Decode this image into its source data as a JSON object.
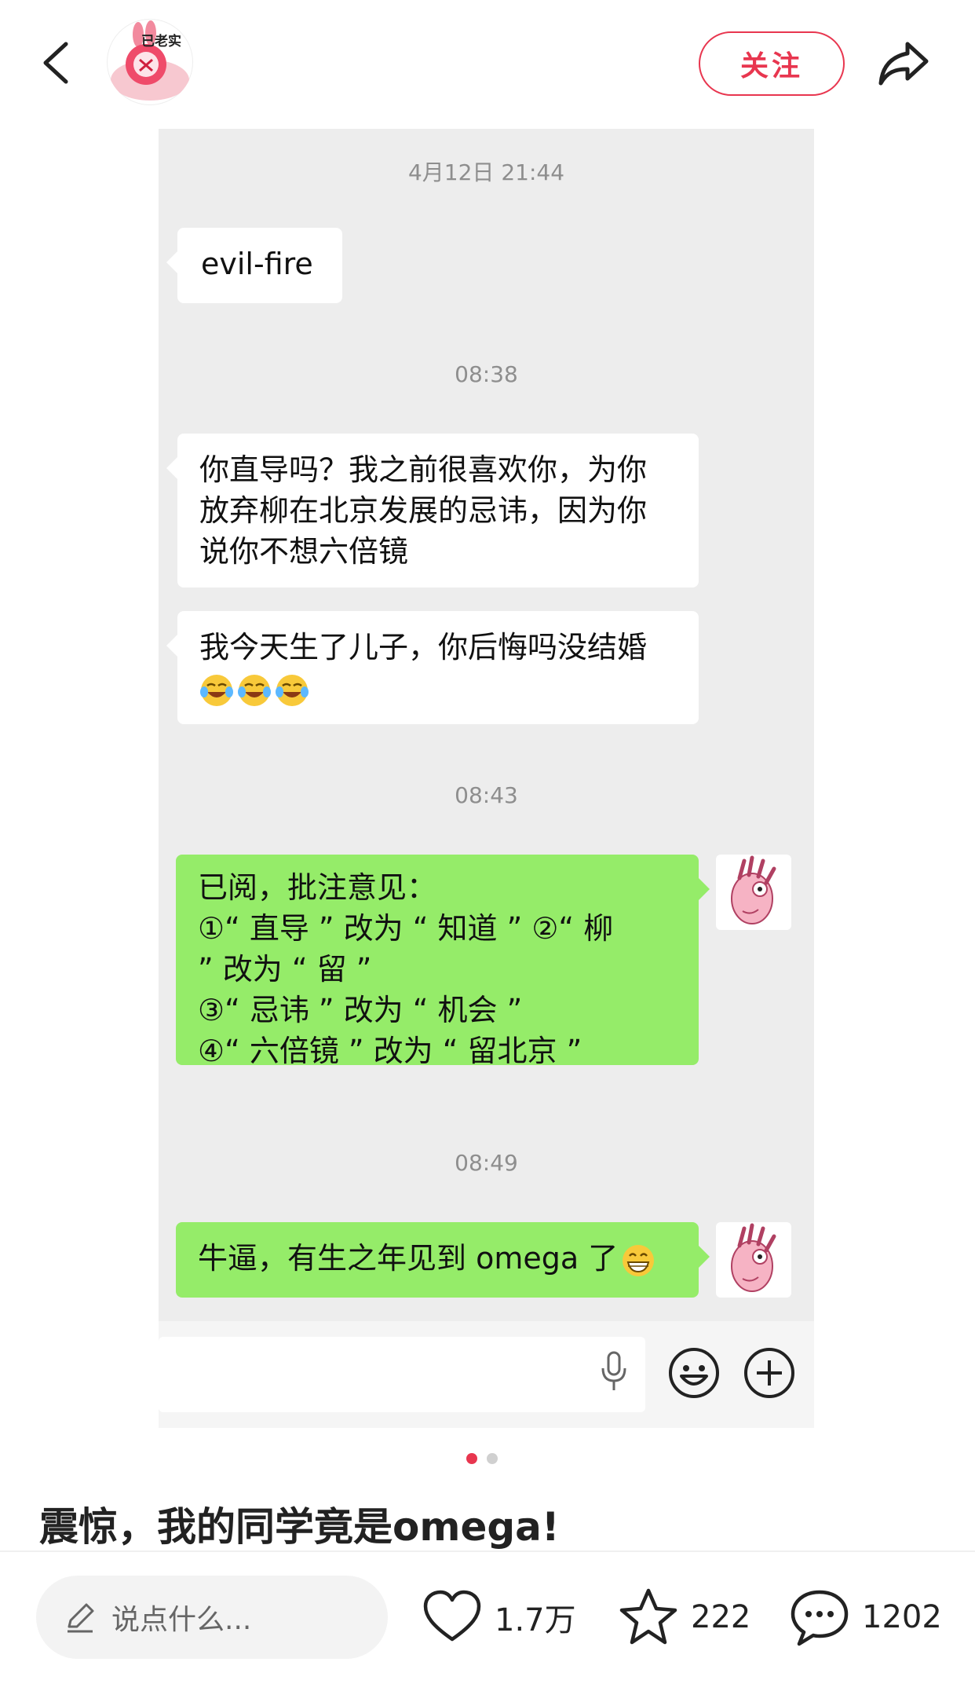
{
  "header": {
    "avatar_text": "已老实",
    "follow_label": "关注"
  },
  "chat": {
    "timestamps": [
      "4月12日 21:44",
      "08:38",
      "08:43",
      "08:49"
    ],
    "msg1": "evil-fire",
    "msg2_lines": [
      "你直导吗？我之前很喜欢你，为你",
      "放弃柳在北京发展的忌讳，因为你",
      "说你不想六倍镜"
    ],
    "msg3_line": "我今天生了儿子，你后悔吗没结婚",
    "msg4_lines": [
      "已阅，批注意见：",
      "①“ 直导 ” 改为 “ 知道 ” ②“ 柳",
      "” 改为 “ 留 ”",
      "③“ 忌讳 ” 改为 “ 机会 ”",
      "④“ 六倍镜 ” 改为 “ 留北京 ”"
    ],
    "msg5": "牛逼，有生之年见到 omega 了",
    "emoji_names": [
      "laughing-crying-emoji",
      "grinning-emoji"
    ]
  },
  "pagination": {
    "count": 2,
    "active": 1
  },
  "post": {
    "title": "震惊，我的同学竟是omega!"
  },
  "bottom_bar": {
    "comment_placeholder": "说点什么...",
    "likes": "1.7万",
    "favorites": "222",
    "comments": "1202"
  },
  "colors": {
    "accent": "#e8364f",
    "chat_bg": "#ededed",
    "bubble_green": "#95ec69",
    "bubble_white": "#ffffff",
    "dot_active": "#e8364f",
    "dot_inactive": "#d0d0d0"
  }
}
